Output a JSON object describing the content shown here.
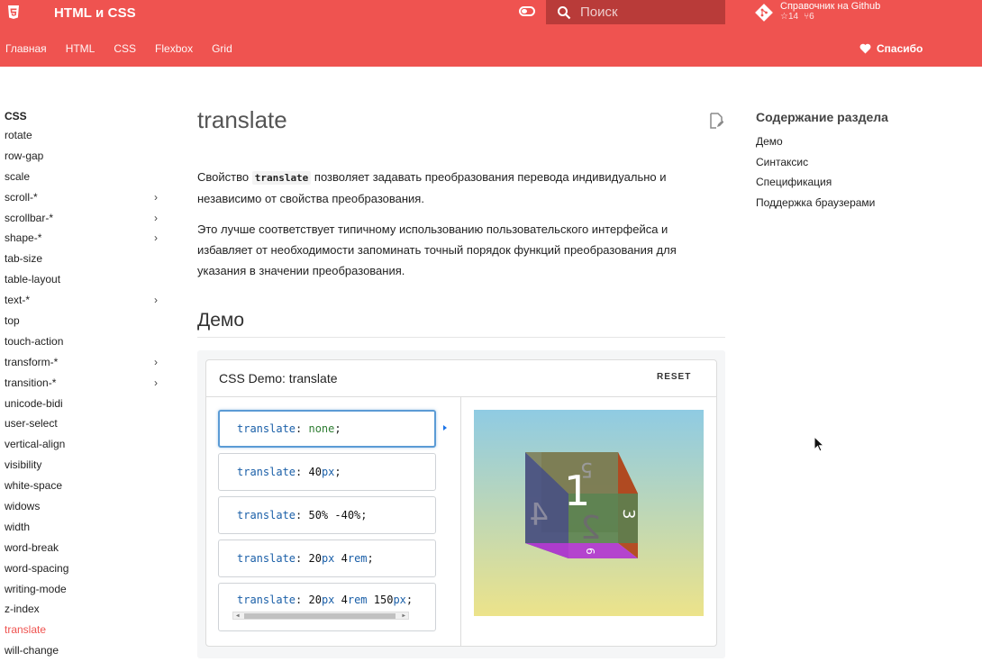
{
  "header": {
    "brand_title": "HTML и CSS",
    "search_placeholder": "Поиск",
    "github_label": "Справочник на Github",
    "github_stars": "14",
    "github_forks": "6",
    "thanks_label": "Спасибо",
    "brand_color": "#ef5350"
  },
  "nav": {
    "items": [
      "Главная",
      "HTML",
      "CSS",
      "Flexbox",
      "Grid"
    ]
  },
  "sidebar": {
    "title": "CSS",
    "items": [
      {
        "label": "rotate",
        "expandable": false
      },
      {
        "label": "row-gap",
        "expandable": false
      },
      {
        "label": "scale",
        "expandable": false
      },
      {
        "label": "scroll-*",
        "expandable": true
      },
      {
        "label": "scrollbar-*",
        "expandable": true
      },
      {
        "label": "shape-*",
        "expandable": true
      },
      {
        "label": "tab-size",
        "expandable": false
      },
      {
        "label": "table-layout",
        "expandable": false
      },
      {
        "label": "text-*",
        "expandable": true
      },
      {
        "label": "top",
        "expandable": false
      },
      {
        "label": "touch-action",
        "expandable": false
      },
      {
        "label": "transform-*",
        "expandable": true
      },
      {
        "label": "transition-*",
        "expandable": true
      },
      {
        "label": "unicode-bidi",
        "expandable": false
      },
      {
        "label": "user-select",
        "expandable": false
      },
      {
        "label": "vertical-align",
        "expandable": false
      },
      {
        "label": "visibility",
        "expandable": false
      },
      {
        "label": "white-space",
        "expandable": false
      },
      {
        "label": "widows",
        "expandable": false
      },
      {
        "label": "width",
        "expandable": false
      },
      {
        "label": "word-break",
        "expandable": false
      },
      {
        "label": "word-spacing",
        "expandable": false
      },
      {
        "label": "writing-mode",
        "expandable": false
      },
      {
        "label": "z-index",
        "expandable": false
      },
      {
        "label": "translate",
        "expandable": false,
        "active": true
      },
      {
        "label": "will-change",
        "expandable": false
      }
    ]
  },
  "main": {
    "title": "translate",
    "p1_before": "Свойство ",
    "p1_code": "translate",
    "p1_after": " позволяет задавать преобразования перевода индивидуально и независимо от свойства преобразования.",
    "p2": "Это лучше соответствует типичному использованию пользовательского интерфейса и избавляет от необходимости запоминать точный порядок функций преобразования для указания в значении преобразования.",
    "demo_heading": "Демо"
  },
  "demo": {
    "title": "CSS Demo: translate",
    "reset_label": "RESET",
    "selected_index": 0,
    "options": [
      {
        "prop": "translate",
        "colon": ": ",
        "parts": [
          [
            "val",
            "none"
          ]
        ],
        "semi": ";"
      },
      {
        "prop": "translate",
        "colon": ": ",
        "parts": [
          [
            "num",
            "40"
          ],
          [
            "unit",
            "px"
          ]
        ],
        "semi": ";"
      },
      {
        "prop": "translate",
        "colon": ": ",
        "parts": [
          [
            "num",
            "50% -40%"
          ]
        ],
        "semi": ";"
      },
      {
        "prop": "translate",
        "colon": ": ",
        "parts": [
          [
            "num",
            "20"
          ],
          [
            "unit",
            "px"
          ],
          [
            "num",
            " 4"
          ],
          [
            "unit",
            "rem"
          ]
        ],
        "semi": ";"
      },
      {
        "prop": "translate",
        "colon": ": ",
        "parts": [
          [
            "num",
            "20"
          ],
          [
            "unit",
            "px"
          ],
          [
            "num",
            " 4"
          ],
          [
            "unit",
            "rem"
          ],
          [
            "num",
            " 150"
          ],
          [
            "unit",
            "px"
          ]
        ],
        "semi": ";"
      }
    ],
    "cube_faces": {
      "front": "1",
      "back": "2",
      "top": "5",
      "left": "4",
      "right": "3",
      "bottom": "6"
    }
  },
  "toc": {
    "title": "Содержание раздела",
    "items": [
      "Демо",
      "Синтаксис",
      "Спецификация",
      "Поддержка браузерами"
    ]
  },
  "icons": [
    "html5-icon",
    "toggle-icon",
    "search-icon",
    "git-icon",
    "heart-icon",
    "edit-icon",
    "chevron-right-icon",
    "mouse-cursor-icon"
  ]
}
